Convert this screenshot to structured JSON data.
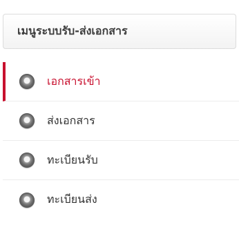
{
  "menu": {
    "title": "เมนูระบบรับ-ส่งเอกสาร",
    "accent_color": "#c8102e",
    "items": [
      {
        "label": "เอกสารเข้า",
        "icon": "radio-bullet-icon",
        "active": true
      },
      {
        "label": "ส่งเอกสาร",
        "icon": "radio-bullet-icon",
        "active": false
      },
      {
        "label": "ทะเบียนรับ",
        "icon": "radio-bullet-icon",
        "active": false
      },
      {
        "label": "ทะเบียนส่ง",
        "icon": "radio-bullet-icon",
        "active": false
      }
    ]
  }
}
